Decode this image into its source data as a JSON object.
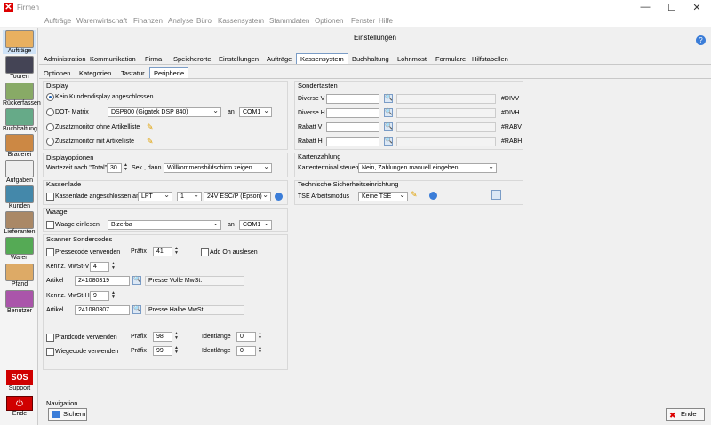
{
  "window": {
    "title": "Firmen",
    "controls": {
      "min": "—",
      "max": "☐",
      "close": "✕"
    }
  },
  "menu": [
    "Aufträge",
    "Warenwirtschaft",
    "Finanzen",
    "Analyse",
    "Büro",
    "Kassensystem",
    "Stammdaten",
    "Optionen",
    "Fenster",
    "Hilfe"
  ],
  "sidebar": [
    {
      "label": "Aufträge",
      "icon": "car-icon"
    },
    {
      "label": "Touren",
      "icon": "truck-icon"
    },
    {
      "label": "Rückerfassen",
      "icon": "return-truck-icon"
    },
    {
      "label": "Buchhaltung",
      "icon": "chart-icon"
    },
    {
      "label": "Brauerei",
      "icon": "bottles-icon"
    },
    {
      "label": "Aufgaben",
      "icon": "tasks-icon"
    },
    {
      "label": "Kunden",
      "icon": "customers-icon"
    },
    {
      "label": "Lieferanten",
      "icon": "supplier-icon"
    },
    {
      "label": "Waren",
      "icon": "goods-icon"
    },
    {
      "label": "Pfand",
      "icon": "crate-icon"
    },
    {
      "label": "Benutzer",
      "icon": "user-icon"
    }
  ],
  "sos": {
    "icon": "SOS",
    "label": "Support"
  },
  "ende_side": {
    "label": "Ende"
  },
  "header": {
    "title": "Einstellungen",
    "help": "?"
  },
  "tabs": [
    "Administration",
    "Kommunikation",
    "Firma",
    "Speicherorte",
    "Einstellungen",
    "Aufträge",
    "Kassensystem",
    "Buchhaltung",
    "Lohnmost",
    "Formulare",
    "Hilfstabellen"
  ],
  "subtabs": [
    "Optionen",
    "Kategorien",
    "Tastatur",
    "Peripherie"
  ],
  "display": {
    "title": "Display",
    "opt1": "Kein Kundendisplay angeschlossen",
    "opt2": "DOT- Matrix",
    "opt2_model": "DSP800 (Gigatek DSP 840)",
    "an": "an",
    "opt2_port": "COM1",
    "opt3": "Zusatzmonitor ohne Artikelliste",
    "opt4": "Zusatzmonitor mit Artikelliste"
  },
  "displayoptionen": {
    "title": "Displayoptionen",
    "wartezeit": "Wartezeit nach \"Total\"",
    "seconds": "30",
    "sek_dann": "Sek., dann",
    "action": "Willkommensbildschirm zeigen"
  },
  "kassenlade": {
    "title": "Kassenlade",
    "label": "Kassenlade angeschlossen an",
    "port": "LPT",
    "num": "1",
    "voltage": "24V ESC/P (Epson)"
  },
  "waage": {
    "title": "Waage",
    "label": "Waage einlesen",
    "model": "Bizerba",
    "an": "an",
    "port": "COM1"
  },
  "scanner": {
    "title": "Scanner Sondercodes",
    "pressecode": "Pressecode verwenden",
    "praefix": "Präfix",
    "praefix1": "41",
    "addon": "Add On auslesen",
    "mwst_v": "Kennz. MwSt-V",
    "mwst_v_val": "4",
    "artikel": "Artikel",
    "artikel1": "241080319",
    "artikel1_desc": "Presse Volle MwSt.",
    "mwst_h": "Kennz. MwSt-H",
    "mwst_h_val": "9",
    "artikel2": "241080307",
    "artikel2_desc": "Presse Halbe MwSt.",
    "pfand": "Pfandcode verwenden",
    "praefix2": "98",
    "identlaenge": "Identlänge",
    "ident1": "0",
    "wiege": "Wiegecode verwenden",
    "praefix3": "99",
    "ident2": "0"
  },
  "sondertasten": {
    "title": "Sondertasten",
    "rows": [
      {
        "label": "Diverse V",
        "code": "#DIVV"
      },
      {
        "label": "Diverse H",
        "code": "#DIVH"
      },
      {
        "label": "Rabatt V",
        "code": "#RABV"
      },
      {
        "label": "Rabatt H",
        "code": "#RABH"
      }
    ]
  },
  "kartenzahlung": {
    "title": "Kartenzahlung",
    "label": "Kartenterminal steuern",
    "value": "Nein, Zahlungen manuell eingeben"
  },
  "tse": {
    "title": "Technische Sicherheitseinrichtung",
    "label": "TSE Arbeitsmodus",
    "value": "Keine TSE"
  },
  "navigation": {
    "title": "Navigation",
    "save": "Sichern",
    "end": "Ende"
  },
  "colors": {
    "accent": "#1a5fb4",
    "sos": "#d00000"
  }
}
